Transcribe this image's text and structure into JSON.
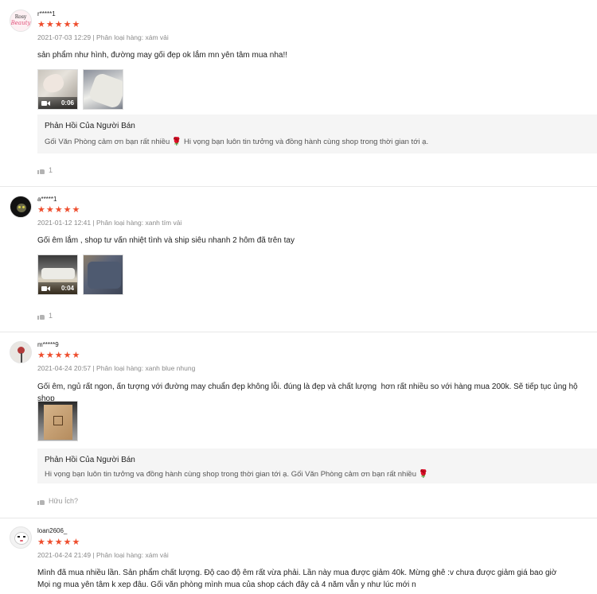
{
  "reviews": [
    {
      "username": "r*****1",
      "stars": "★★★★★",
      "meta": "2021-07-03 12:29 | Phân loại hàng: xám vải",
      "content": "sản phẩm như hình, đường may gối đẹp ok lắm mn yên tâm mua nha!!",
      "video_duration": "0:06",
      "avatar_text": [
        "Rosy",
        "Beauty"
      ],
      "reply": {
        "title": "Phản Hồi Của Người Bán",
        "text_before": "Gối Văn Phòng cảm ơn bạn rất nhiều ",
        "heart": "🌹",
        "text_after": " Hi vọng bạn luôn tin tưởng và đồng hành cùng shop trong thời gian tới ạ."
      },
      "likes": "1"
    },
    {
      "username": "a*****1",
      "stars": "★★★★★",
      "meta": "2021-01-12 12:41 | Phân loại hàng: xanh tím vải",
      "content": "Gối êm lắm , shop tư vấn nhiệt tình và ship siêu nhanh 2 hôm đã trên tay",
      "video_duration": "0:04",
      "likes": "1"
    },
    {
      "username": "m*****9",
      "stars": "★★★★★",
      "meta": "2021-04-24 20:57 | Phân loại hàng: xanh blue nhung",
      "content": "Gối êm, ngủ rất ngon, ấn tượng với đường may chuẩn đẹp không lỗi. đúng là đẹp và chất lượng  hơn rất nhiều so với hàng mua 200k. Sẽ tiếp tục ủng hộ shop",
      "reply": {
        "title": "Phản Hồi Của Người Bán",
        "text_before": "Hi vọng bạn luôn tin tưởng va đồng hành cùng shop trong thời gian tới ạ. Gối Văn Phòng cảm ơn bạn rất nhiều ",
        "heart": "🌹",
        "text_after": ""
      },
      "likes": "Hữu Ích?"
    },
    {
      "username": "loan2606_",
      "stars": "★★★★★",
      "meta": "2021-04-24 21:49 | Phân loại hàng: xám vải",
      "content": "Mình đã mua nhiều lần. Sản phẩm chất lượng. Độ cao độ êm rất vừa phải. Lần này mua được giảm 40k. Mừng ghê :v chưa được giảm giá bao giờ\nMọi ng mua yên tâm k xep đâu. Gối văn phòng mình mua của shop cách đây cả 4 năm vẫn y như lúc mới n"
    }
  ],
  "colors": {
    "star": "#ee4d2d",
    "meta": "#8a8a8a",
    "reply_bg": "#f5f5f5"
  }
}
